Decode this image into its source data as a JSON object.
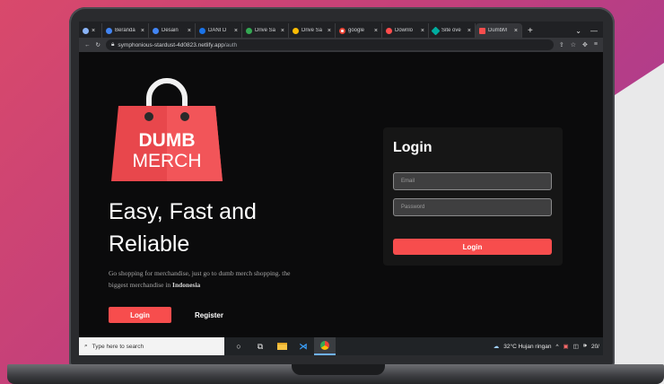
{
  "browser": {
    "tabs": [
      {
        "label": "",
        "favicon_color": "#8ab4f8",
        "active": false
      },
      {
        "label": "Beranda",
        "favicon_color": "#4285f4",
        "active": false
      },
      {
        "label": "Desain",
        "favicon_color": "#4285f4",
        "active": false
      },
      {
        "label": "DANI D",
        "favicon_color": "#1a73e8",
        "active": false
      },
      {
        "label": "Drive Sa",
        "favicon_color": "#34a853",
        "active": false
      },
      {
        "label": "Drive Sa",
        "favicon_color": "#fbbc04",
        "active": false
      },
      {
        "label": "google",
        "favicon_color": "#ea4335",
        "active": false
      },
      {
        "label": "Downlo",
        "favicon_color": "#ff4d4d",
        "active": false
      },
      {
        "label": "Site ove",
        "favicon_color": "#00ad9f",
        "active": false
      },
      {
        "label": "DumbM",
        "favicon_color": "#f74d4d",
        "active": true
      }
    ],
    "tab_close": "×",
    "new_tab": "+",
    "address": {
      "domain": "symphonious-stardust-4d0823.netlify.app",
      "path": "/auth"
    }
  },
  "page": {
    "logo": {
      "line1": "DUMB",
      "line2": "MERCH"
    },
    "hero_title": "Easy, Fast and Reliable",
    "hero_sub": "Go shopping for merchandise, just go to dumb merch shopping. the biggest merchandise in",
    "hero_sub_bold": "Indonesia",
    "login_button": "Login",
    "register_button": "Register",
    "login_card": {
      "title": "Login",
      "email_placeholder": "Email",
      "password_placeholder": "Password",
      "submit": "Login"
    }
  },
  "taskbar": {
    "search_placeholder": "Type here to search",
    "weather": "32°C  Hujan ringan",
    "clock": "20/"
  },
  "colors": {
    "accent": "#f74d4d",
    "page_bg": "#0b0b0c",
    "card_bg": "#161616"
  }
}
